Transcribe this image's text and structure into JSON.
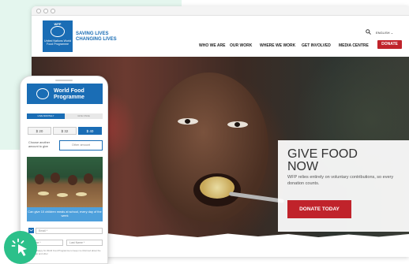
{
  "site": {
    "logo": {
      "acronym": "WFP",
      "name": "United Nations World Food Programme"
    },
    "tagline": "SAVING LIVES\nCHANGING LIVES",
    "language": "ENGLISH",
    "nav": [
      "WHO WE ARE",
      "OUR WORK",
      "WHERE WE WORK",
      "GET INVOLVED",
      "MEDIA CENTRE"
    ],
    "donate_label": "DONATE",
    "colors": {
      "brand_blue": "#1a6db5",
      "donate_red": "#c0232b",
      "accent_green": "#2cc08a"
    }
  },
  "hero": {
    "title": "GIVE FOOD\nNOW",
    "subtitle": "WFP relies entirely on voluntary contributions, so every donation counts.",
    "button": "DONATE TODAY"
  },
  "mobile": {
    "title": "World Food\nProgramme",
    "tabs": [
      "GIVE MONTHLY",
      "GIVE ONCE"
    ],
    "amounts": [
      "$ 20",
      "$ 32",
      "$ 40"
    ],
    "choose_text": "Choose another amount to give",
    "other_placeholder": "Other amount",
    "caption": "Can give 10 children meals at school, every day of the week",
    "email_placeholder": "Email *",
    "first_name_placeholder": "Name *",
    "last_name_placeholder": "Last Name *",
    "note": "Yes, I'm happy for World Food Programme to keep me informed about the campaign and other"
  },
  "icons": [
    "search-icon",
    "chevron-down-icon",
    "mail-icon",
    "click-cursor-icon"
  ]
}
